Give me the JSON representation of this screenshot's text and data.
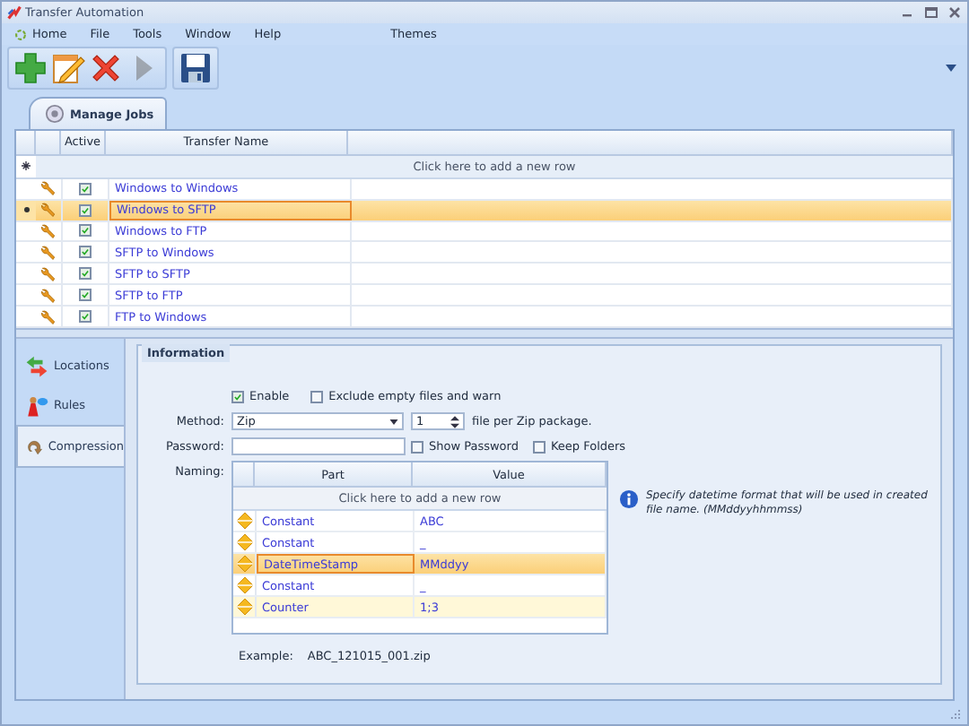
{
  "window": {
    "title": "Transfer Automation"
  },
  "menu": [
    "Home",
    "File",
    "Tools",
    "Window",
    "Help",
    "Themes"
  ],
  "toolbar": [
    {
      "kind": "add",
      "disabled": false
    },
    {
      "kind": "edit",
      "disabled": false
    },
    {
      "kind": "delete",
      "disabled": false
    },
    {
      "kind": "run",
      "disabled": true
    },
    {
      "kind": "save",
      "disabled": false
    }
  ],
  "document_tab": {
    "label": "Manage Jobs"
  },
  "jobs": {
    "columns": [
      "Active",
      "Transfer Name"
    ],
    "new_row": "Click here to add a new row",
    "rows": [
      {
        "active": true,
        "name": "Windows to Windows",
        "selected": false
      },
      {
        "active": true,
        "name": "Windows to SFTP",
        "selected": true
      },
      {
        "active": true,
        "name": "Windows to FTP",
        "selected": false
      },
      {
        "active": true,
        "name": "SFTP to Windows",
        "selected": false
      },
      {
        "active": true,
        "name": "SFTP to SFTP",
        "selected": false
      },
      {
        "active": true,
        "name": "SFTP to FTP",
        "selected": false
      },
      {
        "active": true,
        "name": "FTP to Windows",
        "selected": false
      }
    ]
  },
  "nav": [
    {
      "kind": "locations",
      "label": "Locations",
      "selected": false
    },
    {
      "kind": "rules",
      "label": "Rules",
      "selected": false
    },
    {
      "kind": "compression",
      "label": "Compression",
      "selected": true
    }
  ],
  "information": {
    "title": "Information",
    "enable": {
      "label": "Enable",
      "checked": true
    },
    "exclude_empty": {
      "label": "Exclude empty files and warn",
      "checked": false
    },
    "method": {
      "label": "Method:",
      "value": "Zip"
    },
    "files_per_package": {
      "value": "1",
      "suffix": "file per Zip package."
    },
    "password": {
      "label": "Password:"
    },
    "show_password": {
      "label": "Show Password",
      "checked": false
    },
    "keep_folders": {
      "label": "Keep Folders",
      "checked": false
    },
    "naming": {
      "label": "Naming:",
      "columns": [
        "Part",
        "Value"
      ],
      "new_row": "Click here to add a new row",
      "rows": [
        {
          "part": "Constant",
          "value": "ABC",
          "selected": false,
          "highlighted": false
        },
        {
          "part": "Constant",
          "value": "_",
          "selected": false,
          "highlighted": false
        },
        {
          "part": "DateTimeStamp",
          "value": "MMddyy",
          "selected": true,
          "highlighted": false
        },
        {
          "part": "Constant",
          "value": "_",
          "selected": false,
          "highlighted": false
        },
        {
          "part": "Counter",
          "value": "1;3",
          "selected": false,
          "highlighted": true
        }
      ]
    },
    "example": {
      "label": "Example:",
      "value": "ABC_121015_001.zip"
    },
    "hint": "Specify datetime format that will be used in created file name. (MMddyyhhmmss)"
  }
}
